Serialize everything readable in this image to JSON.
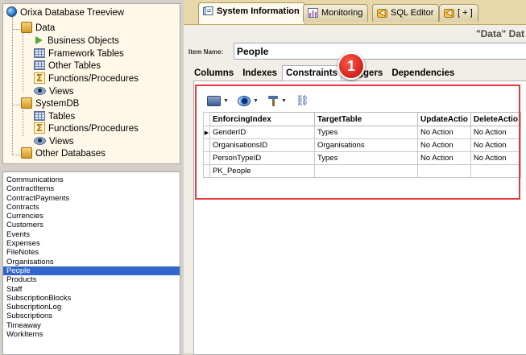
{
  "tree": {
    "title": "Orixa Database Treeview",
    "nodes": [
      {
        "label": "Data",
        "icon": "database-icon"
      },
      {
        "label": "Business Objects",
        "icon": "triangle-play-icon"
      },
      {
        "label": "Framework Tables",
        "icon": "table-grid-icon"
      },
      {
        "label": "Other Tables",
        "icon": "table-grid-icon"
      },
      {
        "label": "Functions/Procedures",
        "icon": "sigma-icon"
      },
      {
        "label": "Views",
        "icon": "eye-icon"
      },
      {
        "label": "SystemDB",
        "icon": "database-icon"
      },
      {
        "label": "Tables",
        "icon": "table-grid-icon"
      },
      {
        "label": "Functions/Procedures",
        "icon": "sigma-icon"
      },
      {
        "label": "Views",
        "icon": "eye-icon"
      },
      {
        "label": "Other Databases",
        "icon": "database-icon"
      }
    ]
  },
  "table_list": {
    "items": [
      "Communications",
      "ContractItems",
      "ContractPayments",
      "Contracts",
      "Currencies",
      "Customers",
      "Events",
      "Expenses",
      "FileNotes",
      "Organisations",
      "People",
      "Products",
      "Staff",
      "SubscriptionBlocks",
      "SubscriptionLog",
      "Subscriptions",
      "Timeaway",
      "WorkItems"
    ],
    "selected": "People"
  },
  "tabs": [
    {
      "label": "System Information",
      "icon": "system-info-icon",
      "active": true
    },
    {
      "label": "Monitoring",
      "icon": "monitoring-icon",
      "active": false
    },
    {
      "label": "SQL Editor",
      "icon": "sql-editor-icon",
      "active": false
    },
    {
      "label": "[ + ]",
      "icon": "add-tab-icon",
      "active": false
    }
  ],
  "header": {
    "title": "\"Data\" Dat"
  },
  "item_name": {
    "label": "Item Name:",
    "value": "People"
  },
  "subtabs": [
    {
      "label": "Columns",
      "active": false
    },
    {
      "label": "Indexes",
      "active": false
    },
    {
      "label": "Constraints",
      "active": true
    },
    {
      "label": "Triggers",
      "active": false
    },
    {
      "label": "Dependencies",
      "active": false
    }
  ],
  "badge": {
    "number": "1"
  },
  "grid": {
    "columns": [
      "EnforcingIndex",
      "TargetTable",
      "UpdateActio",
      "DeleteActio"
    ],
    "rows": [
      [
        "GenderID",
        "Types",
        "No Action",
        "No Action"
      ],
      [
        "OrganisationsID",
        "Organisations",
        "No Action",
        "No Action"
      ],
      [
        "PersonTypeID",
        "Types",
        "No Action",
        "No Action"
      ],
      [
        "PK_People",
        "",
        "",
        ""
      ]
    ],
    "current_row": 0
  },
  "colors": {
    "accent_red": "#e03a3a",
    "selection": "#3366cc",
    "tab_strip": "#e8d7a8"
  }
}
